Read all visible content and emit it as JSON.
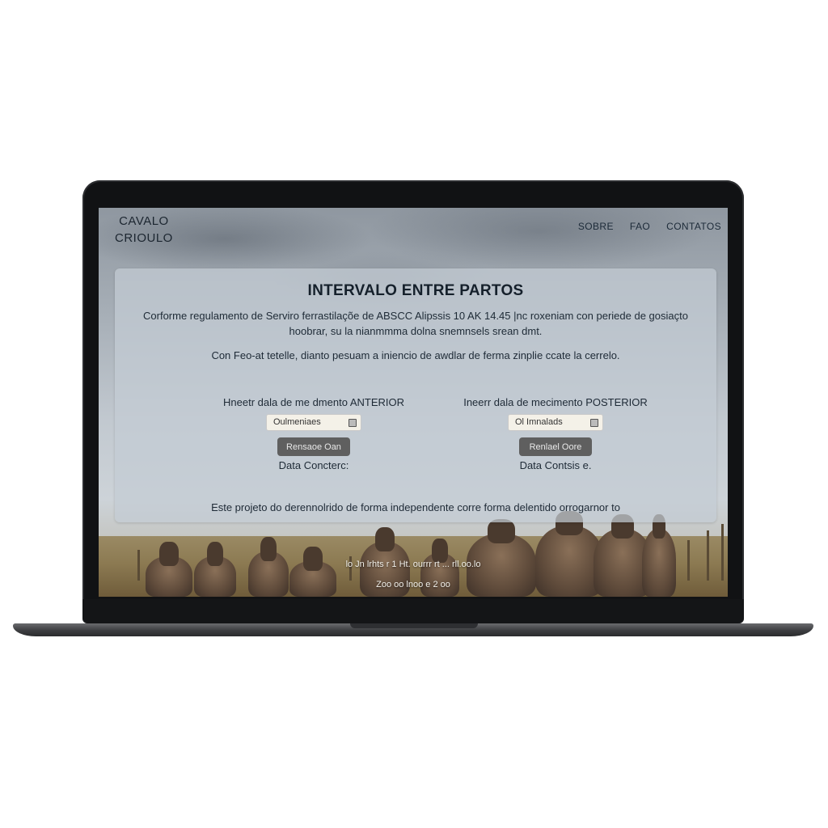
{
  "header": {
    "brand_line1": "CAVALO",
    "brand_line2": "CRIOULO",
    "nav": [
      "SOBRE",
      "FAO",
      "CONTATOS"
    ]
  },
  "main": {
    "title": "INTERVALO ENTRE PARTOS",
    "intro_line1": "Corforme regulamento de Serviro ferrastilaçõe de ABSCC Alipssis 10 AK 14.45 |nc roxeniam con periede de gosiaçto",
    "intro_line2": "hoobrar, su la nianmmma dolna snemnsels srean dmt.",
    "help": "Con Feo-at tetelle, dianto pesuam a iniencio de awdlar de ferma zinplie ccate la cerrelo.",
    "previous": {
      "label": "Hneetr dala de me dmento ANTERIOR",
      "date_value": "Oulmeniaes",
      "button": "Rensaoe Oan",
      "result": "Data Concterc:"
    },
    "next": {
      "label": "Ineerr dala de mecimento POSTERIOR",
      "date_value": "Ol Imnalads",
      "button": "Renlael Oore",
      "result": "Data Contsis e."
    },
    "footer": "Este projeto do derennolrido de forma independente corre forma delentido orrogarnor to"
  },
  "overlay": {
    "line1": "lo Jn lrhts r 1 Ht. ourrr rt ... rll.oo.lo",
    "line2": "Zoo oo lnoo e 2 oo"
  },
  "colors": {
    "button_bg": "#5f5f5f",
    "title_text": "#15202b",
    "card_bg": "#c4ccd4"
  }
}
